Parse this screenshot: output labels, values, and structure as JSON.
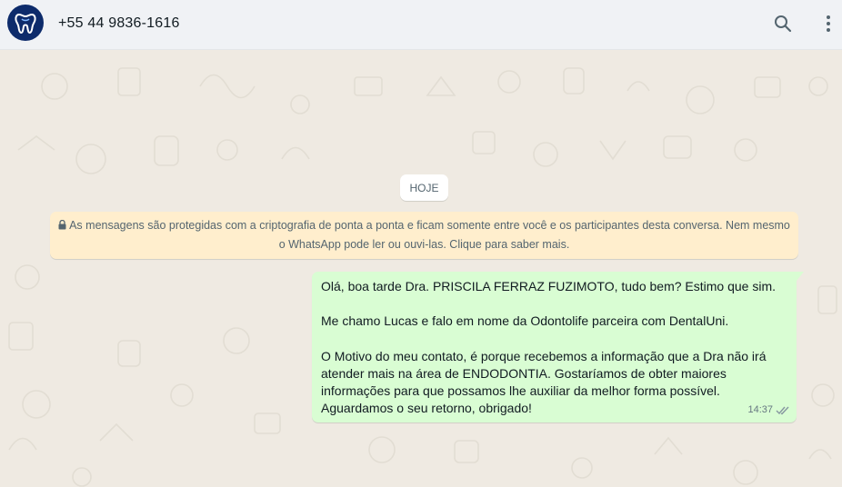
{
  "header": {
    "contact_name": "+55 44 9836-1616",
    "avatar_icon": "tooth-logo-icon",
    "search_icon": "search-icon",
    "menu_icon": "more-vertical-icon"
  },
  "chat": {
    "date_chip": "HOJE",
    "encryption_notice_line1": "As mensagens são protegidas com a criptografia de ponta a ponta e ficam somente entre você e os participantes desta conversa. Nem mesmo",
    "encryption_notice_line2": "o WhatsApp pode ler ou ouvi-las. Clique para saber mais.",
    "message": {
      "para1": "Olá, boa tarde Dra. PRISCILA FERRAZ FUZIMOTO, tudo bem? Estimo que sim.",
      "para2": "Me chamo Lucas e falo em nome da Odontolife parceira com DentalUni.",
      "para3": "O Motivo do meu contato, é porque recebemos a informação que a Dra não irá atender mais na área de ENDODONTIA. Gostaríamos de obter maiores informações para que possamos lhe auxiliar da melhor forma possível. Aguardamos o seu retorno, obrigado!",
      "time": "14:37",
      "status_icon": "double-check-icon"
    }
  },
  "colors": {
    "header_bg": "#f0f2f5",
    "chat_bg": "#efeae2",
    "outgoing_bubble": "#d9fdd3",
    "notice_bg": "#ffeecd",
    "avatar_bg": "#0d2b6b"
  }
}
